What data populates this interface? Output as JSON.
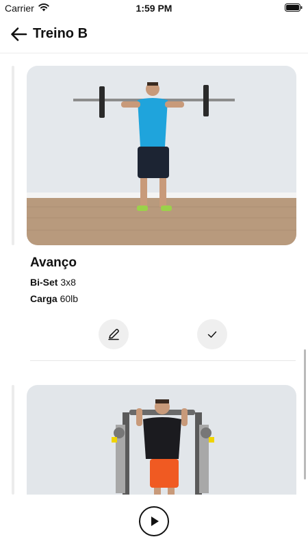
{
  "status_bar": {
    "carrier": "Carrier",
    "time": "1:59 PM"
  },
  "header": {
    "title": "Treino B"
  },
  "exercises": [
    {
      "name": "Avanço",
      "type_label": "Bi-Set",
      "type_value": "3x8",
      "load_label": "Carga",
      "load_value": "60lb"
    }
  ],
  "icons": {
    "back": "arrow-left-icon",
    "edit": "pencil-icon",
    "check": "check-icon",
    "play": "play-icon"
  },
  "colors": {
    "accent": "#111111",
    "button_bg": "#efefef",
    "divider": "#e6e6e6"
  }
}
